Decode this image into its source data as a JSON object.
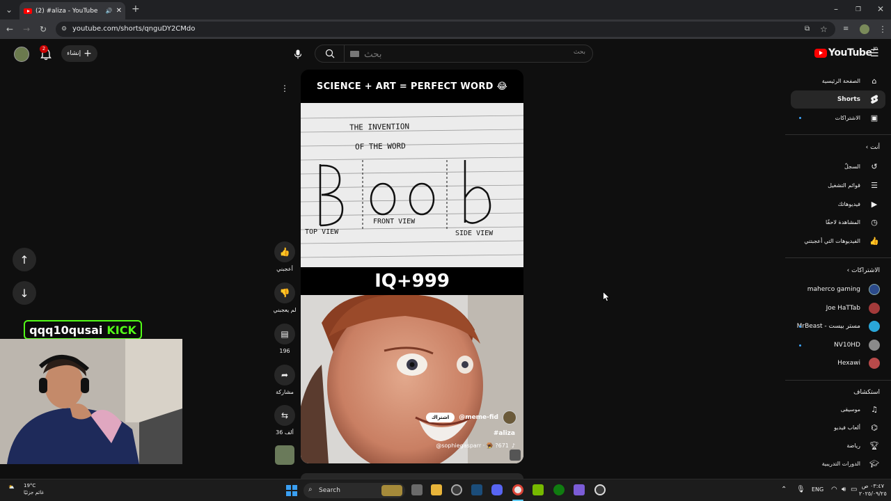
{
  "browser": {
    "tab_title": "(2) #aliza - YouTube",
    "url": "youtube.com/shorts/qnguDY2CMdo"
  },
  "header": {
    "notification_count": "2",
    "create_label": "إنشاء",
    "search_placeholder": "بحث",
    "logo_text": "YouTube",
    "logo_region": "JO"
  },
  "sidebar": {
    "main": [
      {
        "label": "الصفحة الرئيسية",
        "icon": "home-icon"
      },
      {
        "label": "Shorts",
        "icon": "shorts-icon",
        "active": true
      },
      {
        "label": "الاشتراكات",
        "icon": "subscriptions-icon"
      }
    ],
    "you_header": "أنت",
    "you": [
      {
        "label": "السجلّ",
        "icon": "history-icon"
      },
      {
        "label": "قوائم التشغيل",
        "icon": "playlists-icon"
      },
      {
        "label": "فيديوهاتك",
        "icon": "your-videos-icon"
      },
      {
        "label": "المشاهدة لاحقًا",
        "icon": "watch-later-icon"
      },
      {
        "label": "الفيديوهات التي أعجبتني",
        "icon": "liked-videos-icon"
      }
    ],
    "subscriptions_header": "الاشتراكات",
    "subscriptions": [
      {
        "name": "maherco gaming",
        "color": "#2b4a8a"
      },
      {
        "name": "Joe HaTTab",
        "color": "#a33a3a"
      },
      {
        "name": "MrBeast - مستر بيست",
        "color": "#2aa6d8"
      },
      {
        "name": "NV10HD",
        "color": "#8a8a8a"
      },
      {
        "name": "Hexawi",
        "color": "#b84a4a"
      }
    ],
    "explore_header": "استكشاف",
    "explore": [
      {
        "label": "موسيقى",
        "icon": "music-icon"
      },
      {
        "label": "ألعاب فيديو",
        "icon": "gaming-icon"
      },
      {
        "label": "رياضة",
        "icon": "trophy-icon"
      },
      {
        "label": "الدورات التدريبية",
        "icon": "courses-icon"
      }
    ]
  },
  "short": {
    "meme_title": "SCIENCE + ART = PERFECT WORD 😂",
    "paper_line1": "THE INVENTION",
    "paper_line2": "OF THE WORD",
    "paper_labels": [
      "TOP VIEW",
      "FRONT VIEW",
      "SIDE VIEW"
    ],
    "iq_text": "IQ+999",
    "channel": "@meme-fid",
    "subscribe_label": "اشتراك",
    "hashtag": "#aliza",
    "sound": "@sophiegasparr · 🪤 ?671"
  },
  "actions": {
    "like_label": "أعجبني",
    "dislike_label": "لم يعجبني",
    "comments_count": "196",
    "share_label": "مشاركة",
    "remix_count": "36 ألف"
  },
  "overlay": {
    "kick_user": "qqq10qusai",
    "kick_brand": "KICK"
  },
  "taskbar": {
    "temperature": "19°C",
    "weather_text": "غائم جزئيًا",
    "search_label": "Search",
    "language": "ENG",
    "time": "٠٣:٤٧ ص",
    "date": "٢٠٢٥/٠٩/٢٥"
  }
}
